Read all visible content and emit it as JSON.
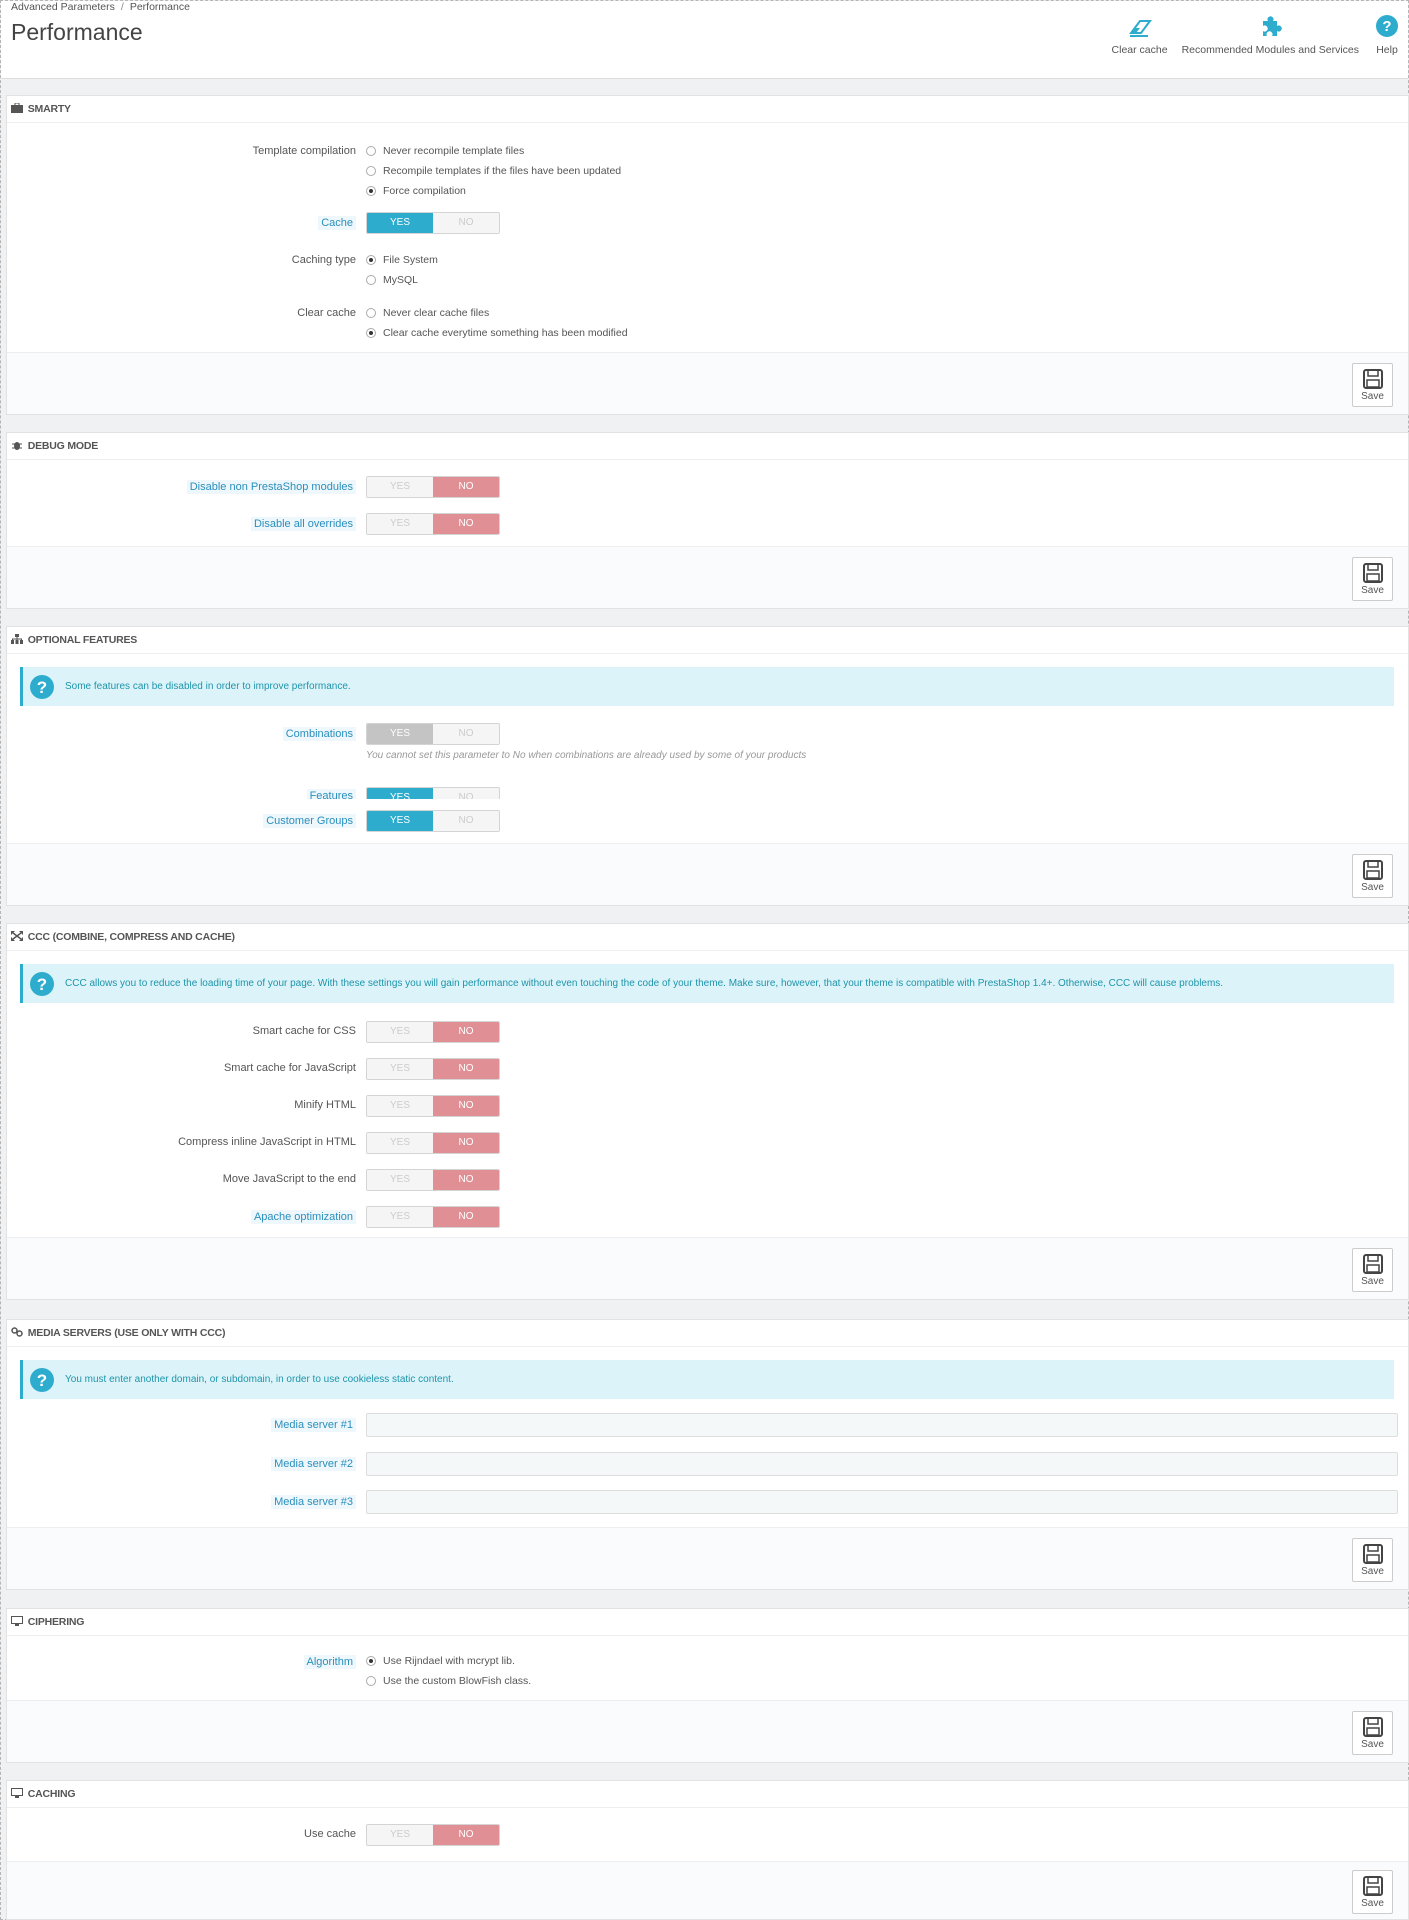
{
  "breadcrumb": {
    "parent": "Advanced Parameters",
    "separator": "/",
    "current": "Performance"
  },
  "page_title": "Performance",
  "toolbar": {
    "clear_cache": "Clear cache",
    "recommended": "Recommended Modules and Services",
    "help": "Help"
  },
  "save_label": "Save",
  "switch": {
    "yes": "YES",
    "no": "NO"
  },
  "smarty": {
    "title": "SMARTY",
    "template_compilation": {
      "label": "Template compilation",
      "options": [
        "Never recompile template files",
        "Recompile templates if the files have been updated",
        "Force compilation"
      ],
      "selected": 2
    },
    "cache": {
      "label": "Cache",
      "value": "YES"
    },
    "caching_type": {
      "label": "Caching type",
      "options": [
        "File System",
        "MySQL"
      ],
      "selected": 0
    },
    "clear_cache": {
      "label": "Clear cache",
      "options": [
        "Never clear cache files",
        "Clear cache everytime something has been modified"
      ],
      "selected": 1
    }
  },
  "debug": {
    "title": "DEBUG MODE",
    "disable_non_prestashop": {
      "label": "Disable non PrestaShop modules",
      "value": "NO"
    },
    "disable_overrides": {
      "label": "Disable all overrides",
      "value": "NO"
    }
  },
  "optional": {
    "title": "OPTIONAL FEATURES",
    "alert": "Some features can be disabled in order to improve performance.",
    "combinations": {
      "label": "Combinations",
      "value": "YES",
      "help": "You cannot set this parameter to No when combinations are already used by some of your products"
    },
    "features": {
      "label": "Features",
      "value": "YES"
    },
    "customer_groups": {
      "label": "Customer Groups",
      "value": "YES"
    }
  },
  "ccc": {
    "title": "CCC (COMBINE, COMPRESS AND CACHE)",
    "alert": "CCC allows you to reduce the loading time of your page. With these settings you will gain performance without even touching the code of your theme. Make sure, however, that your theme is compatible with PrestaShop 1.4+. Otherwise, CCC will cause problems.",
    "rows": [
      {
        "label": "Smart cache for CSS",
        "value": "NO",
        "hint": false
      },
      {
        "label": "Smart cache for JavaScript",
        "value": "NO",
        "hint": false
      },
      {
        "label": "Minify HTML",
        "value": "NO",
        "hint": false
      },
      {
        "label": "Compress inline JavaScript in HTML",
        "value": "NO",
        "hint": false
      },
      {
        "label": "Move JavaScript to the end",
        "value": "NO",
        "hint": false
      },
      {
        "label": "Apache optimization",
        "value": "NO",
        "hint": true
      }
    ]
  },
  "media": {
    "title": "MEDIA SERVERS (USE ONLY WITH CCC)",
    "alert": "You must enter another domain, or subdomain, in order to use cookieless static content.",
    "servers": [
      {
        "label": "Media server #1",
        "value": ""
      },
      {
        "label": "Media server #2",
        "value": ""
      },
      {
        "label": "Media server #3",
        "value": ""
      }
    ]
  },
  "ciphering": {
    "title": "CIPHERING",
    "algorithm": {
      "label": "Algorithm",
      "options": [
        "Use Rijndael with mcrypt lib.",
        "Use the custom BlowFish class."
      ],
      "selected": 0
    }
  },
  "caching": {
    "title": "CACHING",
    "use_cache": {
      "label": "Use cache",
      "value": "NO"
    }
  },
  "colors": {
    "accent": "#2eacce",
    "no_active": "#e08f95",
    "alert_bg": "#dcf4f9"
  }
}
